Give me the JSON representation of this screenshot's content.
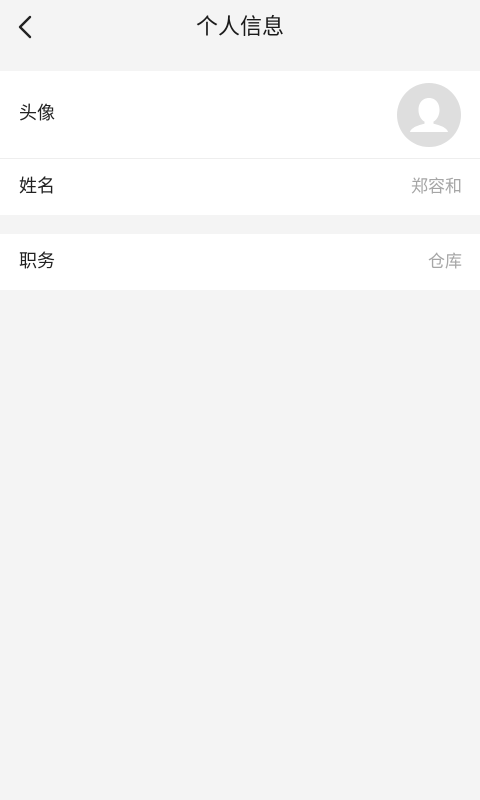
{
  "header": {
    "title": "个人信息",
    "back_icon": "chevron-left-icon"
  },
  "profile": {
    "avatar": {
      "label": "头像",
      "icon": "user-silhouette-icon"
    },
    "name": {
      "label": "姓名",
      "value": "郑容和"
    },
    "role": {
      "label": "职务",
      "value": "仓库"
    }
  },
  "colors": {
    "background": "#f4f4f4",
    "card": "#ffffff",
    "value_text": "#a6a6a6",
    "avatar_bg": "#dedede"
  }
}
